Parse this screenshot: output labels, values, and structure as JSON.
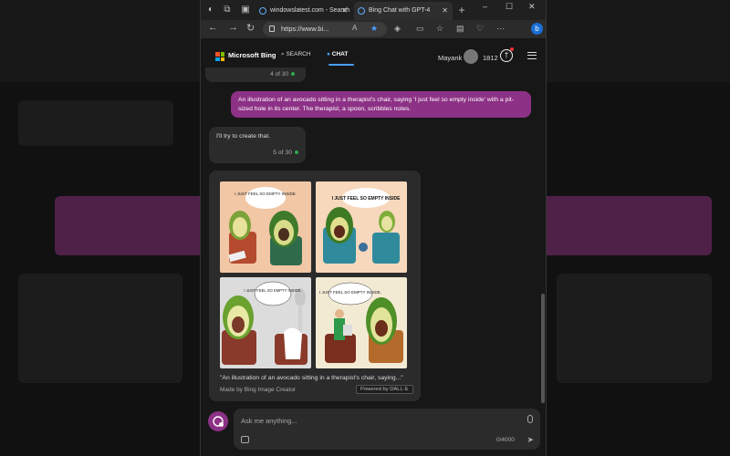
{
  "browser": {
    "tabs": [
      {
        "title": "windowslatest.com - Search"
      },
      {
        "title": "Bing Chat with GPT-4"
      }
    ],
    "new_tab_symbol": "+",
    "url": "https://www.bi...",
    "window_controls": [
      "–",
      "☐",
      "✕"
    ]
  },
  "header": {
    "brand": "Microsoft Bing",
    "nav_search": "SEARCH",
    "nav_chat": "CHAT",
    "user_name": "Mayank",
    "points": "1812"
  },
  "conversation": {
    "prev_counter": "4 of 30",
    "user_prompt": "An illustration of an avocado sitting in a therapist's chair, saying 'I just feel so empty inside' with a pit-sized hole in its center. The therapist, a spoon, scribbles notes.",
    "bot_reply": "I'll try to create that.",
    "bot_counter": "5 of 30"
  },
  "image_card": {
    "images": [
      {
        "bubble": "I JUST FEEL SO EMPTY INSIDE.",
        "bg": "#f1c7a6"
      },
      {
        "bubble": "I JUST FEEL SO EMPTY INSIDE",
        "bg": "#f7d8bd"
      },
      {
        "bubble": "I JUST FEEL SO EMPTY INSIDE.",
        "bg": "#dcdcdc"
      },
      {
        "bubble": "I JUST FEEL SO EMPTY INSIDE.",
        "bg": "#f3ead4"
      }
    ],
    "caption": "\"An illustration of an avocado sitting in a therapist's chair, saying...\"",
    "made_by": "Made by Bing Image Creator",
    "powered_by": "Powered by DALL·E"
  },
  "composer": {
    "placeholder": "Ask me anything...",
    "char_count": "0/4000"
  },
  "colors": {
    "accent_purple": "#8c3185",
    "chat_blue": "#4aa1ff",
    "status_green": "#2fa84f"
  }
}
